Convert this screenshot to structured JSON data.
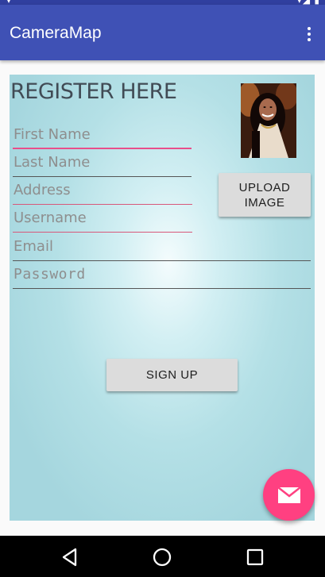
{
  "app": {
    "title": "CameraMap"
  },
  "form": {
    "heading": "REGISTER HERE",
    "fields": {
      "first_name": {
        "placeholder": "First Name",
        "value": ""
      },
      "last_name": {
        "placeholder": "Last Name",
        "value": ""
      },
      "address": {
        "placeholder": "Address",
        "value": ""
      },
      "username": {
        "placeholder": "Username",
        "value": ""
      },
      "email": {
        "placeholder": "Email",
        "value": ""
      },
      "password": {
        "placeholder": "Password",
        "value": ""
      }
    },
    "upload_label_line1": "UPLOAD",
    "upload_label_line2": "IMAGE",
    "signup_label": "SIGN UP"
  },
  "icons": {
    "overflow": "more-vert-icon",
    "fab": "email-icon",
    "nav_back": "back-triangle-icon",
    "nav_home": "home-circle-icon",
    "nav_recents": "recents-square-icon"
  },
  "colors": {
    "primary": "#3f51b5",
    "primary_dark": "#303f9f",
    "accent": "#ff4081",
    "field_error": "#d8587a"
  }
}
